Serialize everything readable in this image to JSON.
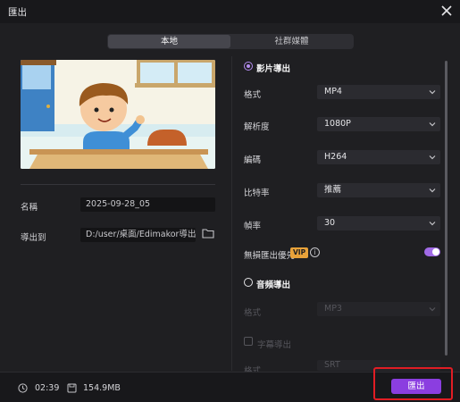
{
  "window": {
    "title": "匯出"
  },
  "tabs": [
    {
      "label": "本地",
      "active": true
    },
    {
      "label": "社群媒體",
      "active": false
    }
  ],
  "left": {
    "name_label": "名稱",
    "name_value": "2025-09-28_05",
    "export_to_label": "導出到",
    "export_to_value": "D:/user/桌面/Edimakor導出"
  },
  "video_export": {
    "title": "影片導出",
    "selected": true,
    "rows": [
      {
        "label": "格式",
        "value": "MP4"
      },
      {
        "label": "解析度",
        "value": "1080P"
      },
      {
        "label": "編碼",
        "value": "H264"
      },
      {
        "label": "比特率",
        "value": "推薦"
      },
      {
        "label": "幀率",
        "value": "30"
      }
    ],
    "lossless_label": "無損匯出優先",
    "vip_badge": "VIP",
    "info_glyph": "i",
    "lossless_on": true
  },
  "audio_export": {
    "title": "音頻導出",
    "selected": false,
    "format_label": "格式",
    "format_value": "MP3"
  },
  "subtitle_export": {
    "label": "字幕導出",
    "checked": false,
    "format_label": "格式",
    "format_value": "SRT"
  },
  "footer": {
    "duration": "02:39",
    "size": "154.9MB",
    "export_button": "匯出"
  },
  "colors": {
    "accent": "#8b3ee0",
    "toggle": "#a06ae6",
    "vip": "#e8a23a",
    "highlight": "#e11d24"
  }
}
